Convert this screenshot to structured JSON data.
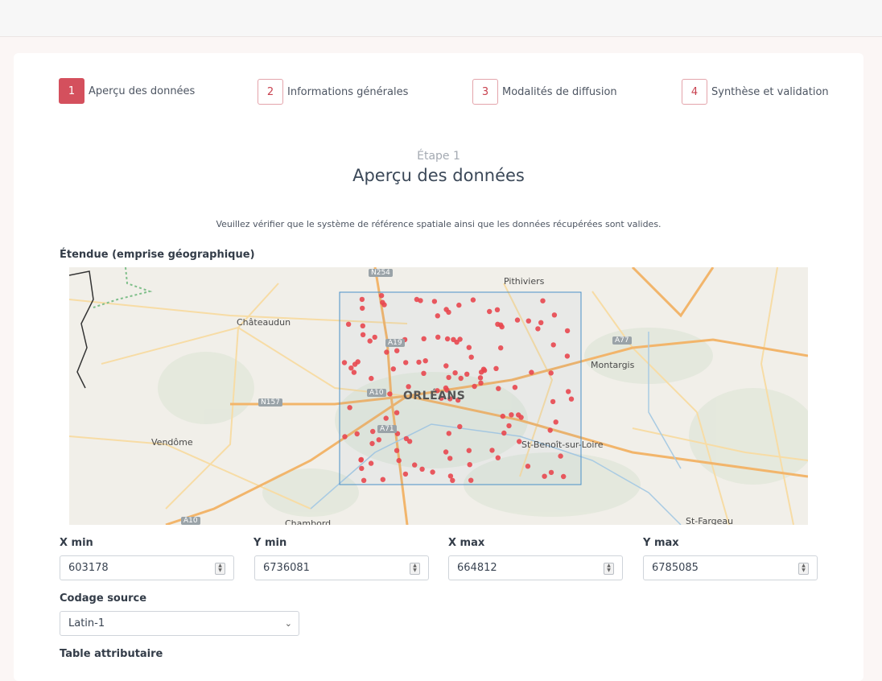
{
  "stepper": {
    "steps": [
      {
        "number": "1",
        "label": "Aperçu des données",
        "active": true
      },
      {
        "number": "2",
        "label": "Informations générales",
        "active": false
      },
      {
        "number": "3",
        "label": "Modalités de diffusion",
        "active": false
      },
      {
        "number": "4",
        "label": "Synthèse et validation",
        "active": false
      }
    ]
  },
  "header": {
    "kicker": "Étape 1",
    "title": "Aperçu des données",
    "instructions": "Veuillez vérifier que le système de référence spatiale ainsi que les données récupérées sont valides."
  },
  "extent": {
    "label": "Étendue (emprise géographique)",
    "map": {
      "places": [
        "Pithiviers",
        "Châteaudun",
        "Montargis",
        "ORLÉANS",
        "Vendôme",
        "St-Benoît-sur-Loire",
        "St-Fargeau",
        "Chambord"
      ],
      "road_shields": [
        "N254",
        "A19",
        "A10",
        "A71",
        "N157",
        "A77",
        "A10"
      ],
      "point_color": "#e8474f",
      "bbox_color": "#4a90c8"
    },
    "fields": {
      "xmin": {
        "label": "X min",
        "value": "603178"
      },
      "ymin": {
        "label": "Y min",
        "value": "6736081"
      },
      "xmax": {
        "label": "X max",
        "value": "664812"
      },
      "ymax": {
        "label": "Y max",
        "value": "6785085"
      }
    }
  },
  "encoding": {
    "label": "Codage source",
    "selected": "Latin-1"
  },
  "attribute_table": {
    "label": "Table attributaire"
  },
  "colors": {
    "accent": "#d4505d",
    "background": "#fbf6f5"
  }
}
